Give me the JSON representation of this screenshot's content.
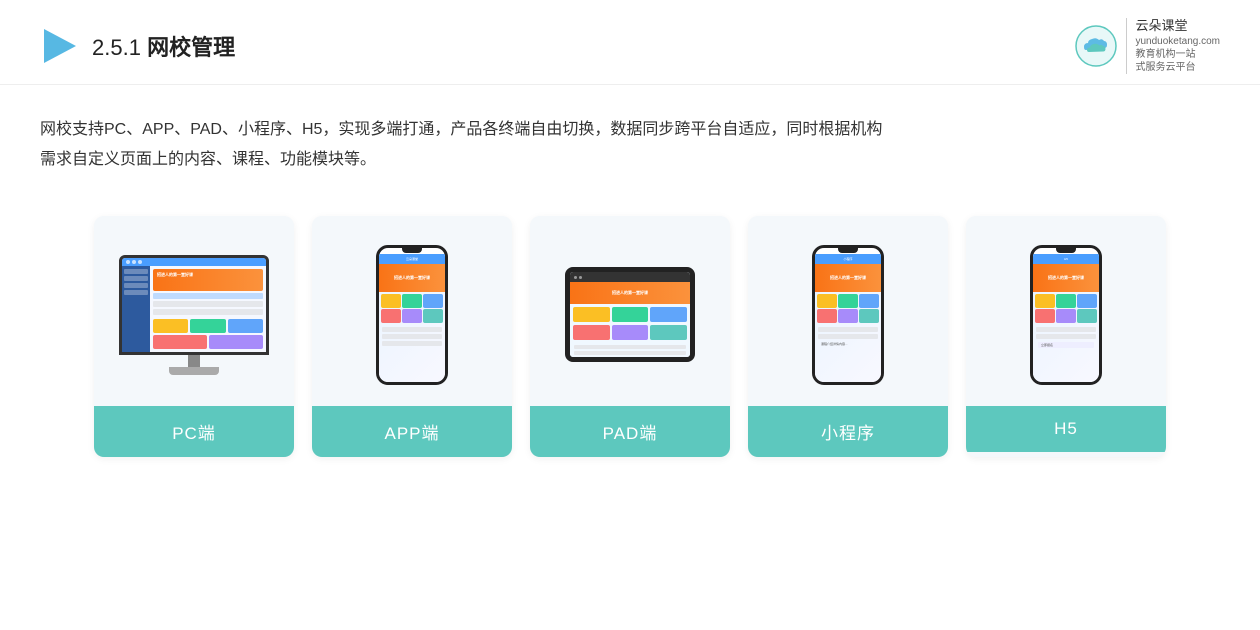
{
  "header": {
    "section_number": "2.5.1",
    "title_main": "网校管理",
    "logo_name": "云朵课堂",
    "logo_url": "yunduoketang.com",
    "logo_tagline1": "教育机构一站",
    "logo_tagline2": "式服务云平台"
  },
  "description": {
    "text_line1": "网校支持PC、APP、PAD、小程序、H5，实现多端打通，产品各终端自由切换，数据同步跨平台自适应，同时根据机构",
    "text_line2": "需求自定义页面上的内容、课程、功能模块等。"
  },
  "cards": [
    {
      "id": "pc",
      "label": "PC端",
      "type": "monitor"
    },
    {
      "id": "app",
      "label": "APP端",
      "type": "phone"
    },
    {
      "id": "pad",
      "label": "PAD端",
      "type": "tablet"
    },
    {
      "id": "miniprogram",
      "label": "小程序",
      "type": "phone"
    },
    {
      "id": "h5",
      "label": "H5",
      "type": "phone"
    }
  ],
  "colors": {
    "teal": "#5dc8be",
    "accent": "#f97316",
    "blue": "#4a9eff",
    "dark": "#222222"
  }
}
